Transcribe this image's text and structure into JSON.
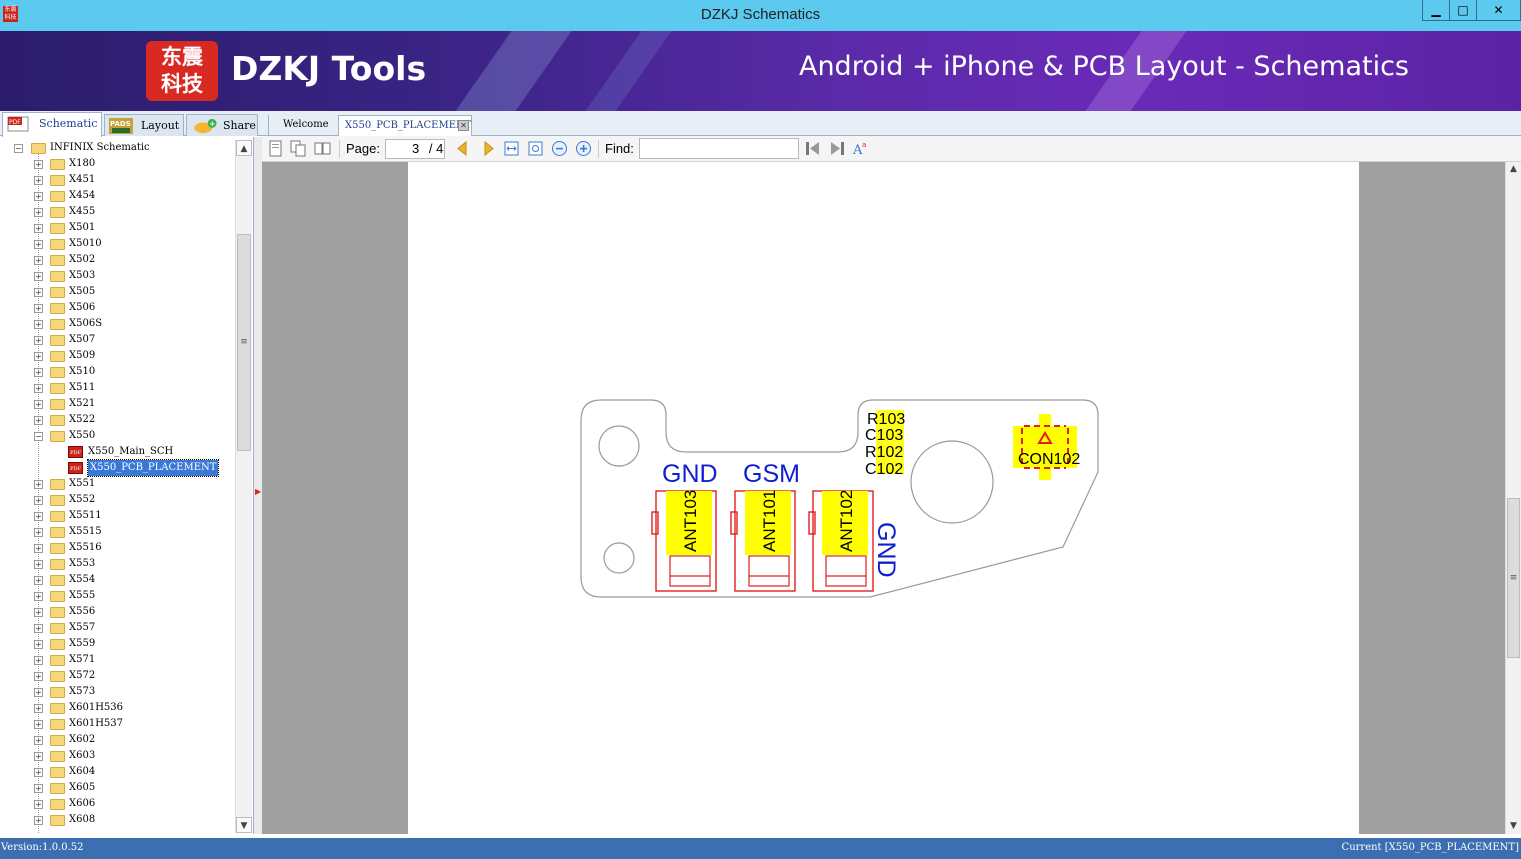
{
  "window": {
    "title": "DZKJ Schematics",
    "minimize": "▁",
    "maximize": "□",
    "close": "✕",
    "app_icon_text": "东震\n科技"
  },
  "banner": {
    "logo_chars": "东震\n科技",
    "logo_text": "DZKJ Tools",
    "tagline": "Android + iPhone & PCB Layout - Schematics"
  },
  "left_tabs": [
    {
      "label": "Schematic",
      "icon": "pdf-icon",
      "active": true
    },
    {
      "label": "Layout",
      "icon": "pads-icon",
      "active": false
    },
    {
      "label": "Share",
      "icon": "cloud-share-icon",
      "active": false
    }
  ],
  "tree": {
    "root": "INFINIX Schematic",
    "items": [
      {
        "label": "X180",
        "expanded": false
      },
      {
        "label": "X451",
        "expanded": false
      },
      {
        "label": "X454",
        "expanded": false
      },
      {
        "label": "X455",
        "expanded": false
      },
      {
        "label": "X501",
        "expanded": false
      },
      {
        "label": "X5010",
        "expanded": false
      },
      {
        "label": "X502",
        "expanded": false
      },
      {
        "label": "X503",
        "expanded": false
      },
      {
        "label": "X505",
        "expanded": false
      },
      {
        "label": "X506",
        "expanded": false
      },
      {
        "label": "X506S",
        "expanded": false
      },
      {
        "label": "X507",
        "expanded": false
      },
      {
        "label": "X509",
        "expanded": false
      },
      {
        "label": "X510",
        "expanded": false
      },
      {
        "label": "X511",
        "expanded": false
      },
      {
        "label": "X521",
        "expanded": false
      },
      {
        "label": "X522",
        "expanded": false
      },
      {
        "label": "X550",
        "expanded": true,
        "children": [
          {
            "label": "X550_Main_SCH",
            "selected": false
          },
          {
            "label": "X550_PCB_PLACEMENT",
            "selected": true
          }
        ]
      },
      {
        "label": "X551",
        "expanded": false
      },
      {
        "label": "X552",
        "expanded": false
      },
      {
        "label": "X5511",
        "expanded": false
      },
      {
        "label": "X5515",
        "expanded": false
      },
      {
        "label": "X5516",
        "expanded": false
      },
      {
        "label": "X553",
        "expanded": false
      },
      {
        "label": "X554",
        "expanded": false
      },
      {
        "label": "X555",
        "expanded": false
      },
      {
        "label": "X556",
        "expanded": false
      },
      {
        "label": "X557",
        "expanded": false
      },
      {
        "label": "X559",
        "expanded": false
      },
      {
        "label": "X571",
        "expanded": false
      },
      {
        "label": "X572",
        "expanded": false
      },
      {
        "label": "X573",
        "expanded": false
      },
      {
        "label": "X601H536",
        "expanded": false
      },
      {
        "label": "X601H537",
        "expanded": false
      },
      {
        "label": "X602",
        "expanded": false
      },
      {
        "label": "X603",
        "expanded": false
      },
      {
        "label": "X604",
        "expanded": false
      },
      {
        "label": "X605",
        "expanded": false
      },
      {
        "label": "X606",
        "expanded": false
      },
      {
        "label": "X608",
        "expanded": false
      }
    ]
  },
  "doc_tabs": [
    {
      "label": "Welcome",
      "active": false
    },
    {
      "label": "X550_PCB_PLACEMENT",
      "active": true
    }
  ],
  "toolbar": {
    "page_label": "Page:",
    "page_current": "3",
    "page_total": "/ 4",
    "find_label": "Find:",
    "find_value": ""
  },
  "pcb": {
    "labels": {
      "gnd_left": "GND",
      "gsm": "GSM",
      "gnd_right": "GND",
      "ant103": "ANT103",
      "ant101": "ANT101",
      "ant102": "ANT102",
      "r103": "R103",
      "c103": "C103",
      "r102": "R102",
      "c102": "C102",
      "con102": "CON102"
    },
    "colors": {
      "pad": "#ffff00",
      "outline": "#e02020",
      "net": "#1020d0",
      "board": "#9a9a9a"
    }
  },
  "status": {
    "version": "Version:1.0.0.52",
    "current": "Current [X550_PCB_PLACEMENT]"
  }
}
